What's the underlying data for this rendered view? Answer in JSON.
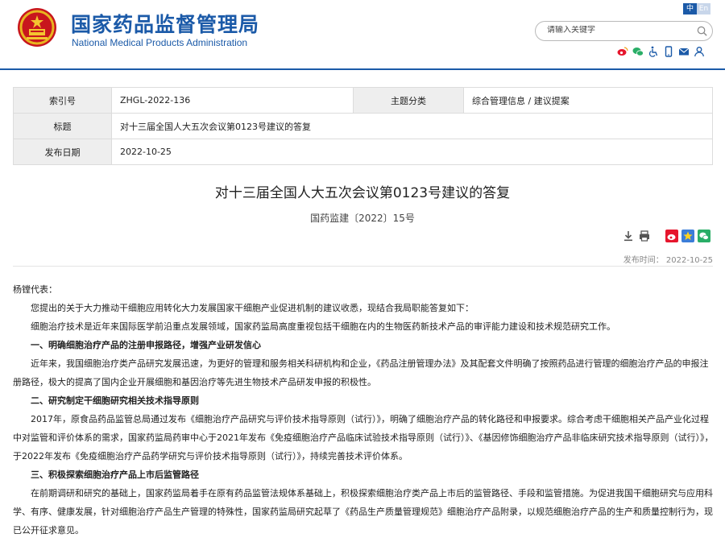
{
  "header": {
    "site_title": "国家药品监督管理局",
    "site_subtitle": "National Medical Products Administration",
    "lang_zh": "中",
    "lang_en": "En",
    "search_placeholder": "请输入关键字",
    "brand_color": "#1b5aa8"
  },
  "utility_icons": [
    "weibo-icon",
    "wechat-icon",
    "accessibility-icon",
    "mobile-icon",
    "email-icon",
    "user-icon"
  ],
  "meta": {
    "index_label": "索引号",
    "index_value": "ZHGL-2022-136",
    "category_label": "主题分类",
    "category_value": "综合管理信息 / 建议提案",
    "title_label": "标题",
    "title_value": "对十三届全国人大五次会议第0123号建议的答复",
    "date_label": "发布日期",
    "date_value": "2022-10-25"
  },
  "article": {
    "title": "对十三届全国人大五次会议第0123号建议的答复",
    "doc_number": "国药监建〔2022〕15号",
    "publish_time": "发布时间：  2022-10-25",
    "salutation": "杨镗代表：",
    "paragraphs": [
      "您提出的关于大力推动干细胞应用转化大力发展国家干细胞产业促进机制的建议收悉，现结合我局职能答复如下：",
      "细胞治疗技术是近年来国际医学前沿重点发展领域，国家药监局高度重视包括干细胞在内的生物医药新技术产品的审评能力建设和技术规范研究工作。"
    ],
    "section1_heading": "一、明确细胞治疗产品的注册申报路径，增强产业研发信心",
    "section1_text": "近年来，我国细胞治疗类产品研究发展迅速，为更好的管理和服务相关科研机构和企业，《药品注册管理办法》及其配套文件明确了按照药品进行管理的细胞治疗产品的申报注册路径，极大的提高了国内企业开展细胞和基因治疗等先进生物技术产品研发申报的积极性。",
    "section2_heading": "二、研究制定干细胞研究相关技术指导原则",
    "section2_text": "2017年，原食品药品监管总局通过发布《细胞治疗产品研究与评价技术指导原则（试行）》，明确了细胞治疗产品的转化路径和申报要求。综合考虑干细胞相关产品产业化过程中对监管和评价体系的需求，国家药监局药审中心于2021年发布《免疫细胞治疗产品临床试验技术指导原则（试行）》、《基因修饰细胞治疗产品非临床研究技术指导原则（试行）》，于2022年发布《免疫细胞治疗产品药学研究与评价技术指导原则（试行）》，持续完善技术评价体系。",
    "section3_heading": "三、积极探索细胞治疗产品上市后监管路径",
    "section3_text": "在前期调研和研究的基础上，国家药监局着手在原有药品监管法规体系基础上，积极探索细胞治疗类产品上市后的监管路径、手段和监管措施。为促进我国干细胞研究与应用科学、有序、健康发展，针对细胞治疗产品生产管理的特殊性，国家药监局研究起草了《药品生产质量管理规范》细胞治疗产品附录，以规范细胞治疗产品的生产和质量控制行为，现已公开征求意见。"
  },
  "article_tools": [
    "download-icon",
    "print-icon",
    "weibo-share-icon",
    "favorite-icon",
    "wechat-share-icon"
  ]
}
